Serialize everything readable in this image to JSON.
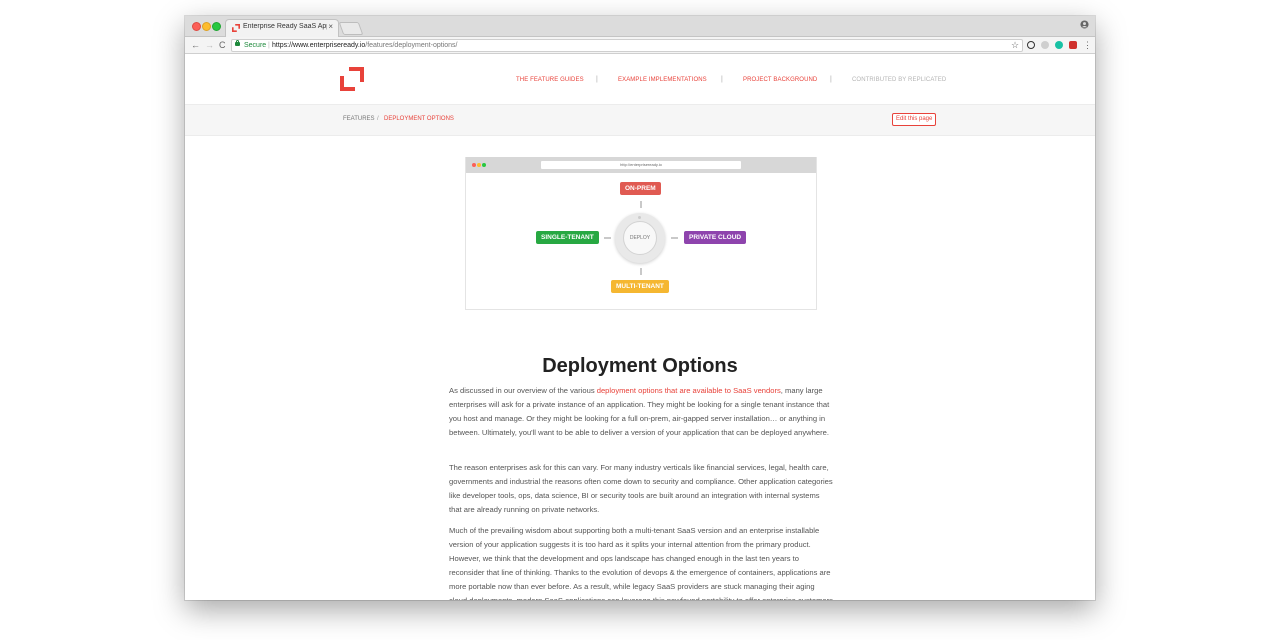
{
  "browser": {
    "tab_title": "Enterprise Ready SaaS App Gu",
    "tab_close": "×",
    "secure_label": "Secure",
    "url_host": "https://www.enterpriseready.io",
    "url_path": "/features/deployment-options/",
    "nav_back": "←",
    "nav_forward": "→",
    "nav_reload": "C",
    "bookmark_star": "☆",
    "menu_dots": "⋮",
    "extension_colors": [
      "#333333",
      "#cfcfcf",
      "#19c1a4",
      "#d0312d"
    ]
  },
  "site": {
    "accent_color": "#e8423a",
    "nav": {
      "feature_guides": "THE FEATURE GUIDES",
      "example_implementations": "EXAMPLE IMPLEMENTATIONS",
      "project_background": "PROJECT BACKGROUND",
      "contributed_by": "CONTRIBUTED BY REPLICATED",
      "separator": "|"
    },
    "breadcrumb": {
      "features": "FEATURES",
      "separator": "/",
      "current": "DEPLOYMENT OPTIONS"
    },
    "edit_button": "Edit this page"
  },
  "hero": {
    "url": "http://enterpriseready.io",
    "center_label": "DEPLOY",
    "on_prem": "ON-PREM",
    "single_tenant": "SINGLE-TENANT",
    "private_cloud": "PRIVATE CLOUD",
    "multi_tenant": "MULTI-TENANT",
    "colors": {
      "on_prem": "#e05a52",
      "single_tenant": "#27a842",
      "private_cloud": "#8e44ad",
      "multi_tenant": "#f5b731"
    }
  },
  "article": {
    "title": "Deployment Options",
    "p1_before": "As discussed in our overview of the various ",
    "p1_link": "deployment options that are available to SaaS vendors",
    "p1_after": ", many large enterprises will ask for a private instance of an application. They might be looking for a single tenant instance that you host and manage. Or they might be looking for a full on-prem, air-gapped server installation… or anything in between. Ultimately, you'll want to be able to deliver a version of your application that can be deployed anywhere.",
    "p2": "The reason enterprises ask for this can vary. For many industry verticals like financial services, legal, health care, governments and industrial the reasons often come down to security and compliance. Other application categories like developer tools, ops, data science, BI or security tools are built around an integration with internal systems that are already running on private networks.",
    "p3": "Much of the prevailing wisdom about supporting both a multi-tenant SaaS version and an enterprise installable version of your application suggests it is too hard as it splits your internal attention from the primary product. However, we think that the development and ops landscape has changed enough in the last ten years to reconsider that line of thinking. Thanks to the evolution of devops & the emergence of containers, applications are more portable now than ever before. As a result, while legacy SaaS providers are stuck managing their aging cloud deployments, modern SaaS applications can leverage this newfound portability to offer enterprise customers the choice of their preferred deployment option."
  }
}
